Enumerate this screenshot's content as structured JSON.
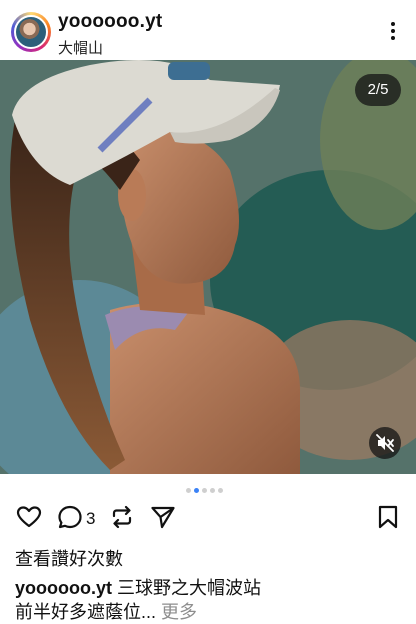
{
  "header": {
    "username": "yoooooo.yt",
    "location": "大帽山"
  },
  "post": {
    "image_counter": "2/5",
    "carousel_total": 5,
    "carousel_active_index": 2
  },
  "actions": {
    "comment_count": "3"
  },
  "likes_label": "查看讚好次數",
  "caption": {
    "username": "yoooooo.yt",
    "text_line1": "三球野之大帽波站",
    "text_line2": "前半好多遮蔭位...",
    "more_label": "更多"
  },
  "icons": {
    "more": "more-vertical-icon",
    "mute": "muted-speaker-icon",
    "like": "heart-icon",
    "comment": "comment-icon",
    "repost": "repost-icon",
    "share": "send-icon",
    "save": "bookmark-icon"
  }
}
